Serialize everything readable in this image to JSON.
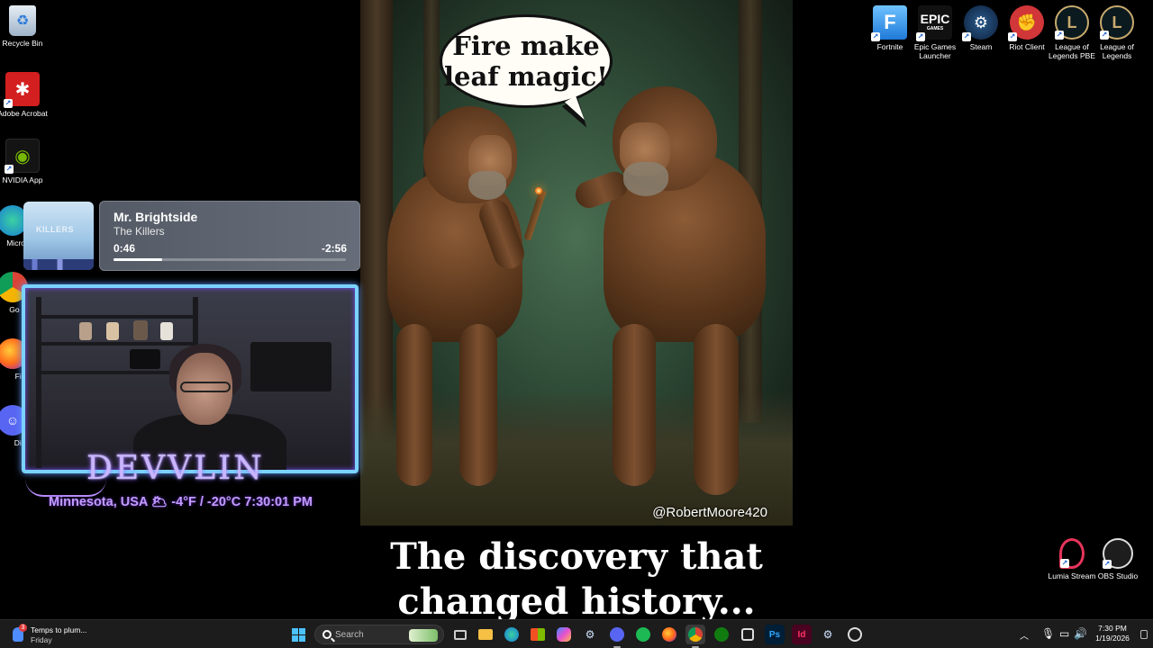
{
  "desktop_left_icons": [
    {
      "label": "Recycle Bin",
      "icon": "recycle-bin-icon"
    },
    {
      "label": "Adobe Acrobat",
      "icon": "adobe-acrobat-icon"
    },
    {
      "label": "NVIDIA App",
      "icon": "nvidia-icon"
    },
    {
      "label": "Micro Ed",
      "icon": "edge-icon"
    },
    {
      "label": "Go Chr",
      "icon": "chrome-icon"
    },
    {
      "label": "Fire",
      "icon": "firefox-icon"
    },
    {
      "label": "Disc",
      "icon": "discord-icon"
    }
  ],
  "desktop_right_icons": [
    {
      "label": "Fortnite",
      "icon": "fortnite-icon"
    },
    {
      "label": "Epic Games Launcher",
      "icon": "epic-games-icon",
      "art": "EPIC",
      "art_sub": "GAMES"
    },
    {
      "label": "Steam",
      "icon": "steam-icon"
    },
    {
      "label": "Riot Client",
      "icon": "riot-client-icon"
    },
    {
      "label": "League of Legends PBE",
      "icon": "league-pbe-icon"
    },
    {
      "label": "League of Legends",
      "icon": "league-icon"
    }
  ],
  "desktop_bottom_right_icons": [
    {
      "label": "Lumia Stream",
      "icon": "lumia-stream-icon"
    },
    {
      "label": "OBS Studio",
      "icon": "obs-studio-icon"
    }
  ],
  "meme": {
    "speech_line1": "Fire make",
    "speech_line2": "leaf magic!",
    "credit": "@RobertMoore420",
    "caption_line1": "The discovery that",
    "caption_line2": "changed history..."
  },
  "music": {
    "title": "Mr. Brightside",
    "artist": "The Killers",
    "elapsed": "0:46",
    "remaining": "-2:56",
    "progress": 0.21,
    "album_art_text": "KILLERS"
  },
  "webcam_overlay": {
    "name": "DEVVLIN",
    "weather": "Minnesota, USA  🌥  -4°F / -20°C  7:30:01 PM"
  },
  "taskbar": {
    "notification_title": "Temps to plum...",
    "notification_subtitle": "Friday",
    "notification_badge": "3",
    "search_placeholder": "Search",
    "apps": [
      {
        "name": "start-button",
        "icon": "windows-start-icon"
      },
      {
        "name": "task-view",
        "icon": "task-view-icon"
      },
      {
        "name": "file-explorer",
        "icon": "folder-icon"
      },
      {
        "name": "edge",
        "icon": "edge-icon"
      },
      {
        "name": "store",
        "icon": "store-icon"
      },
      {
        "name": "copilot",
        "icon": "copilot-icon"
      },
      {
        "name": "steam",
        "icon": "steam-icon"
      },
      {
        "name": "discord",
        "icon": "discord-icon"
      },
      {
        "name": "spotify",
        "icon": "spotify-icon"
      },
      {
        "name": "firefox",
        "icon": "firefox-icon"
      },
      {
        "name": "chrome",
        "icon": "chrome-icon"
      },
      {
        "name": "xbox",
        "icon": "xbox-icon"
      },
      {
        "name": "snipping-tool",
        "icon": "snipping-tool-icon"
      },
      {
        "name": "photoshop",
        "icon": "photoshop-icon",
        "text": "Ps"
      },
      {
        "name": "indesign",
        "icon": "indesign-icon",
        "text": "Id"
      },
      {
        "name": "steam-2",
        "icon": "steam-icon"
      },
      {
        "name": "chatgpt",
        "icon": "chatgpt-icon"
      }
    ],
    "time": "7:30 PM",
    "date": "1/19/2026"
  },
  "colors": {
    "taskbar": "#1c1c1c",
    "webcam_border": "#7ad2ff",
    "overlay_purple": "#c39bff",
    "music_panel": "#5f656f"
  }
}
